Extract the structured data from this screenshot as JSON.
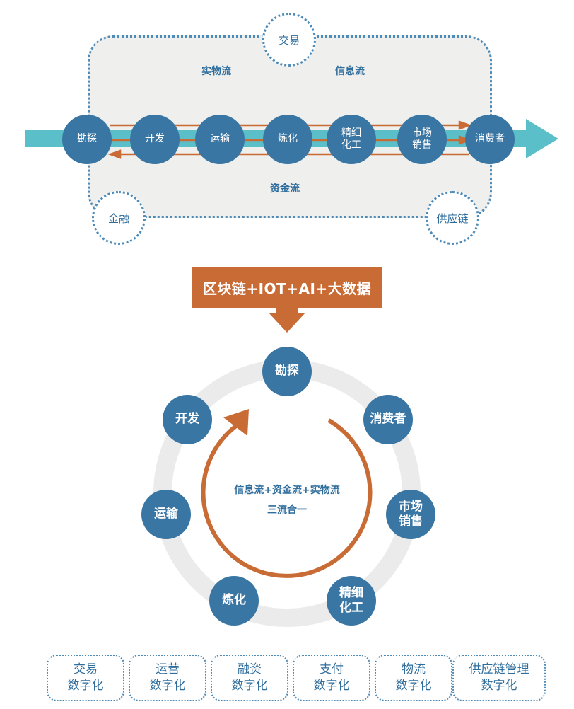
{
  "top_diagram": {
    "chain_nodes": [
      "勘探",
      "开发",
      "运输",
      "炼化",
      "精细\n化工",
      "市场\n销售",
      "消费者"
    ],
    "flow_labels": {
      "material": "实物流",
      "information": "信息流",
      "capital": "资金流"
    },
    "corner_nodes": {
      "trade": "交易",
      "finance": "金融",
      "supply_chain": "供应链"
    }
  },
  "tech_banner": "区块链+IOT+AI+大数据",
  "cycle": {
    "nodes": {
      "explore": "勘探",
      "consumer": "消费者",
      "market": "市场\n销售",
      "fine_chem": "精细\n化工",
      "refine": "炼化",
      "transport": "运输",
      "develop": "开发"
    },
    "center_line1": "信息流+资金流+实物流",
    "center_line2": "三流合一"
  },
  "digitalization_boxes": [
    "交易\n数字化",
    "运营\n数字化",
    "融资\n数字化",
    "支付\n数字化",
    "物流\n数字化",
    "供应链管理\n数字化"
  ],
  "colors": {
    "node_blue": "#3a76a3",
    "arrow_teal": "#5bbfc9",
    "accent_orange": "#c96b34",
    "panel_gray": "#efefed",
    "ring_gray": "#ebebeb"
  }
}
